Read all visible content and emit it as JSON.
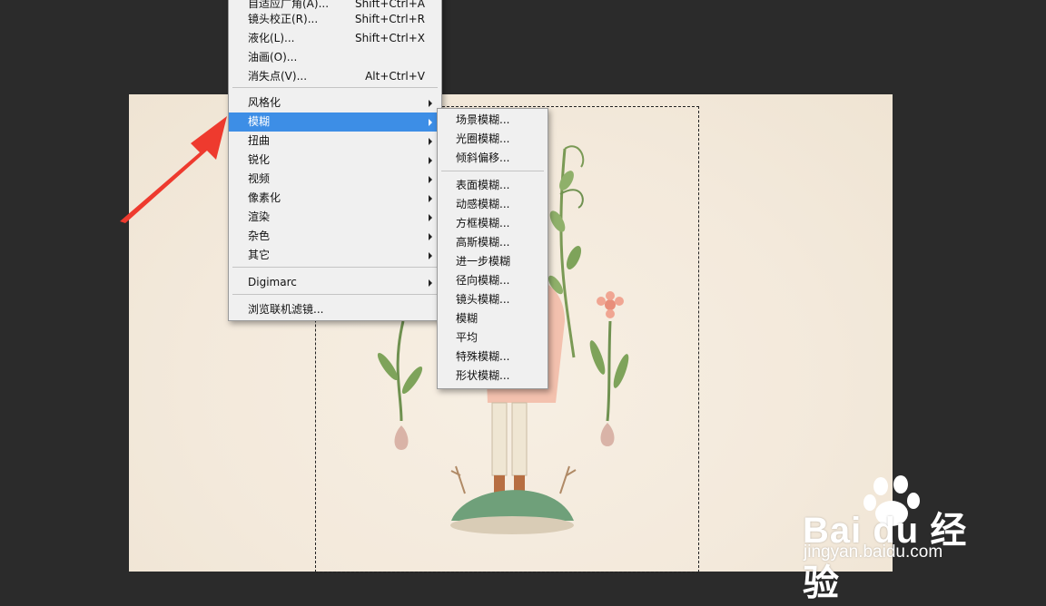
{
  "main_menu": {
    "items": [
      {
        "label": "自适应广角(A)...",
        "shortcut": "Shift+Ctrl+A",
        "submenu": false
      },
      {
        "label": "镜头校正(R)...",
        "shortcut": "Shift+Ctrl+R",
        "submenu": false
      },
      {
        "label": "液化(L)...",
        "shortcut": "Shift+Ctrl+X",
        "submenu": false
      },
      {
        "label": "油画(O)...",
        "shortcut": "",
        "submenu": false
      },
      {
        "label": "消失点(V)...",
        "shortcut": "Alt+Ctrl+V",
        "submenu": false
      },
      {
        "label": "风格化",
        "shortcut": "",
        "submenu": true
      },
      {
        "label": "模糊",
        "shortcut": "",
        "submenu": true,
        "active": true
      },
      {
        "label": "扭曲",
        "shortcut": "",
        "submenu": true
      },
      {
        "label": "锐化",
        "shortcut": "",
        "submenu": true
      },
      {
        "label": "视频",
        "shortcut": "",
        "submenu": true
      },
      {
        "label": "像素化",
        "shortcut": "",
        "submenu": true
      },
      {
        "label": "渲染",
        "shortcut": "",
        "submenu": true
      },
      {
        "label": "杂色",
        "shortcut": "",
        "submenu": true
      },
      {
        "label": "其它",
        "shortcut": "",
        "submenu": true
      },
      {
        "label": "Digimarc",
        "shortcut": "",
        "submenu": true
      },
      {
        "label": "浏览联机滤镜...",
        "shortcut": "",
        "submenu": false
      }
    ]
  },
  "blur_submenu": {
    "items": [
      "场景模糊...",
      "光圈模糊...",
      "倾斜偏移...",
      "表面模糊...",
      "动感模糊...",
      "方框模糊...",
      "高斯模糊...",
      "进一步模糊",
      "径向模糊...",
      "镜头模糊...",
      "模糊",
      "平均",
      "特殊模糊...",
      "形状模糊..."
    ]
  },
  "watermark": {
    "logo": "Bai du 经验",
    "url": "jingyan.baidu.com"
  },
  "colors": {
    "highlight": "#3d8ee6",
    "arrow": "#ee3a2e",
    "workspace": "#2b2b2b"
  }
}
